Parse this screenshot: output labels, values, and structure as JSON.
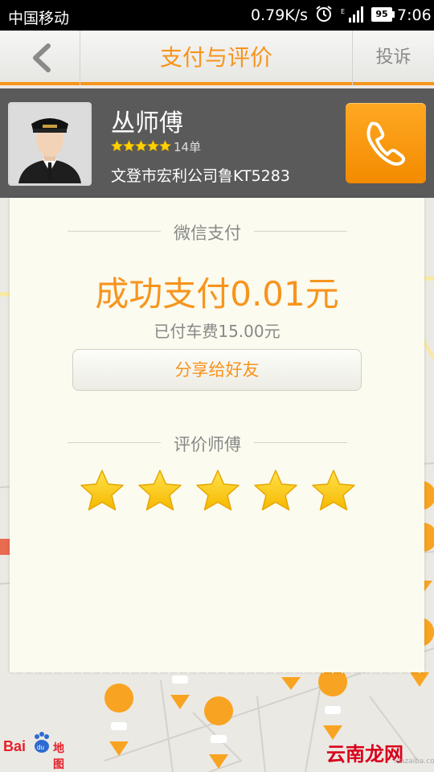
{
  "status_bar": {
    "carrier": "中国移动",
    "net_speed": "0.79K/s",
    "battery": "95",
    "time": "7:06"
  },
  "header": {
    "title": "支付与评价",
    "complain_label": "投诉"
  },
  "driver": {
    "name": "丛师傅",
    "rating_stars": 5,
    "orders": "14单",
    "company_plate": "文登市宏利公司鲁KT5283"
  },
  "payment": {
    "method_label": "微信支付",
    "success_text": "成功支付0.01元",
    "fare_text": "已付车费15.00元",
    "share_label": "分享给好友"
  },
  "review": {
    "section_label": "评价师傅",
    "stars": 5
  },
  "map": {
    "logo_text": "Bai",
    "logo_suffix": "地图"
  },
  "watermark": {
    "text": "云南龙网",
    "url": "xiazaiba.com"
  },
  "colors": {
    "accent": "#f7941d",
    "driver_bar": "#5a5a5a",
    "card": "#fbfbef"
  }
}
